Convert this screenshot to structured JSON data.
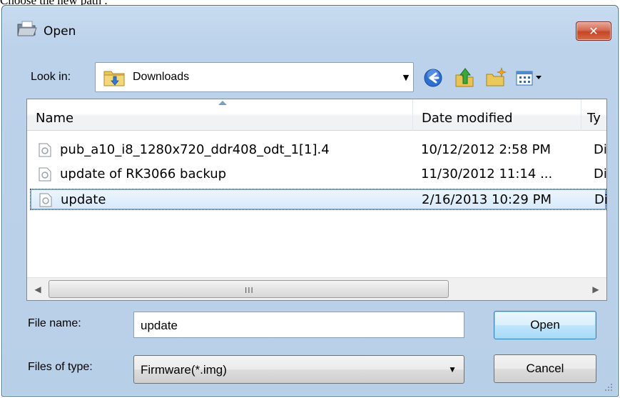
{
  "caption": "Choose the new path .",
  "window": {
    "title": "Open",
    "close_label": "✕"
  },
  "look_in": {
    "label": "Look in:",
    "value": "Downloads",
    "toolbar": [
      "back-icon",
      "up-folder-icon",
      "new-folder-icon",
      "view-menu-icon"
    ]
  },
  "file_list": {
    "columns": {
      "name": "Name",
      "date": "Date modified",
      "type": "Ty"
    },
    "rows": [
      {
        "name": "pub_a10_i8_1280x720_ddr408_odt_1[1].4",
        "date": "10/12/2012 2:58 PM",
        "type": "Di",
        "selected": false
      },
      {
        "name": "update of RK3066 backup",
        "date": "11/30/2012 11:14 ...",
        "type": "Di",
        "selected": false
      },
      {
        "name": "update",
        "date": "2/16/2013 10:29 PM",
        "type": "Di",
        "selected": true
      }
    ],
    "scrollbar": {
      "left": "◀",
      "right": "▶",
      "grip": "III"
    }
  },
  "file_name": {
    "label": "File name:",
    "value": "update"
  },
  "file_type": {
    "label": "Files of type:",
    "value": "Firmware(*.img)"
  },
  "buttons": {
    "open": "Open",
    "cancel": "Cancel"
  },
  "colors": {
    "title_bar": "#c7dbf0",
    "close_button": "#c44626",
    "selected_row": "#d6e9fb"
  }
}
